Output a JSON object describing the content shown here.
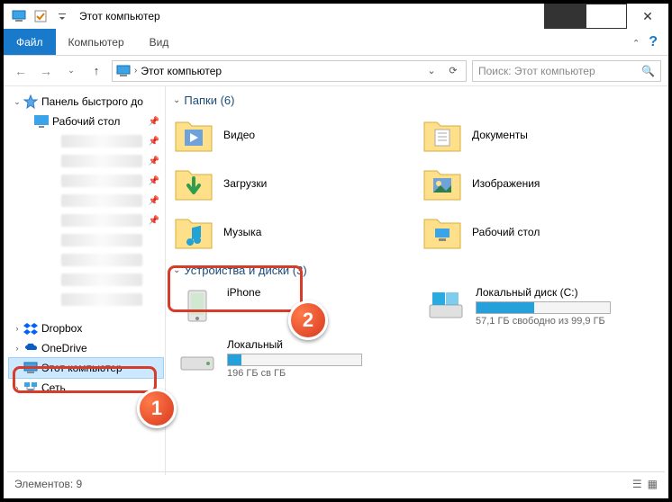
{
  "window": {
    "title": "Этот компьютер"
  },
  "ribbon": {
    "file": "Файл",
    "computer": "Компьютер",
    "view": "Вид"
  },
  "address": {
    "path": "Этот компьютер",
    "search_placeholder": "Поиск: Этот компьютер"
  },
  "sidebar": {
    "quick_access": "Панель быстрого до",
    "desktop": "Рабочий стол",
    "dropbox": "Dropbox",
    "onedrive": "OneDrive",
    "this_pc": "Этот компьютер",
    "network": "Сеть"
  },
  "sections": {
    "folders_header": "Папки (6)",
    "devices_header": "Устройства и диски (3)"
  },
  "folders": {
    "video": "Видео",
    "documents": "Документы",
    "downloads": "Загрузки",
    "pictures": "Изображения",
    "music": "Музыка",
    "desktop": "Рабочий стол"
  },
  "devices": {
    "iphone": "iPhone",
    "disk_c_name": "Локальный диск (C:)",
    "disk_c_info": "57,1 ГБ свободно из 99,9 ГБ",
    "disk_local_name": "Локальный",
    "disk_local_info": "196 ГБ св                       ГБ",
    "disk_c_fill_pct": 43
  },
  "statusbar": {
    "elements": "Элементов: 9"
  },
  "badges": {
    "one": "1",
    "two": "2"
  }
}
